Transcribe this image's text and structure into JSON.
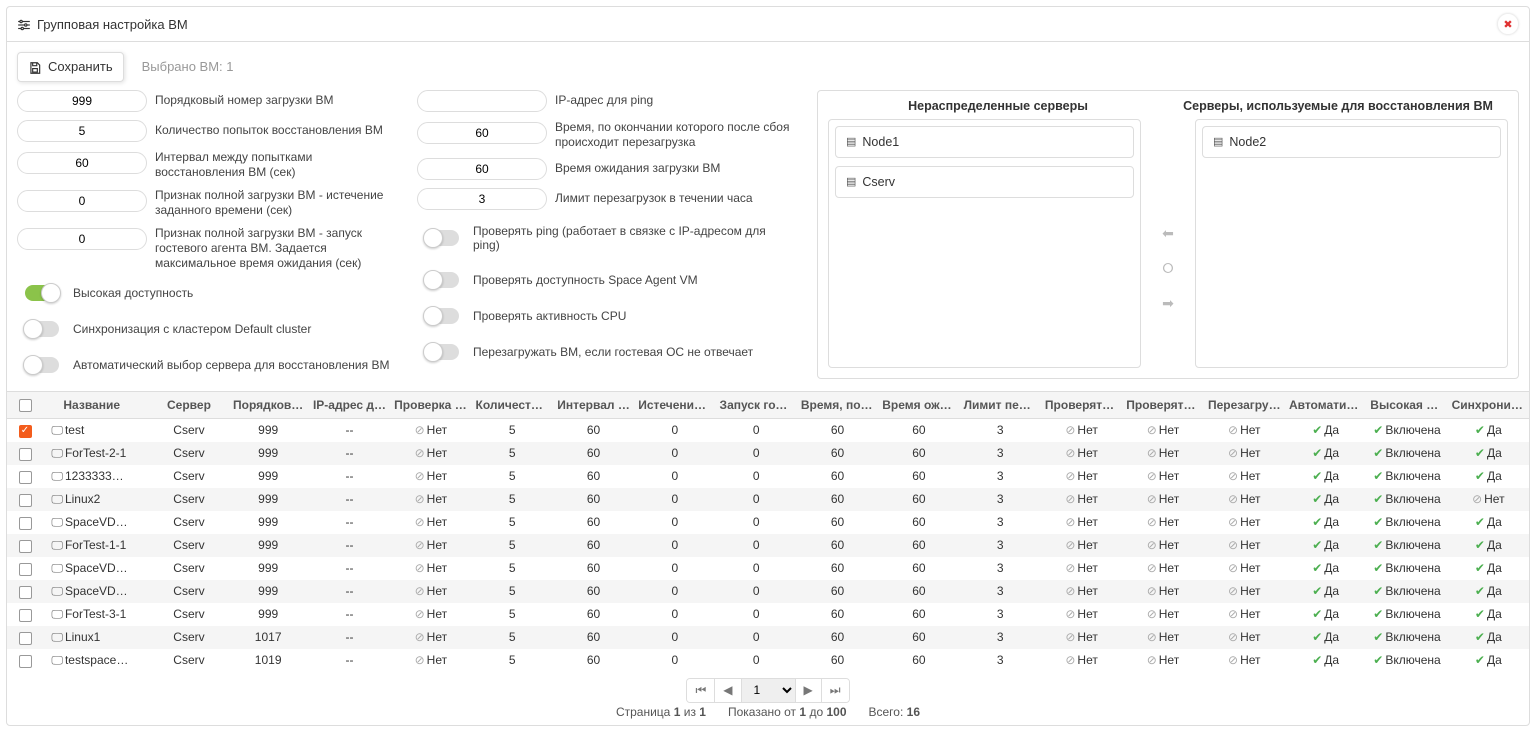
{
  "header": {
    "title": "Групповая настройка ВМ"
  },
  "toolbar": {
    "saveLabel": "Сохранить",
    "selectedLabel": "Выбрано ВМ: 1"
  },
  "left_fields": [
    {
      "value": "999",
      "label": "Порядковый номер загрузки ВМ"
    },
    {
      "value": "5",
      "label": "Количество попыток восстановления ВМ"
    },
    {
      "value": "60",
      "label": "Интервал между попытками восстановления ВМ (сек)"
    },
    {
      "value": "0",
      "label": "Признак полной загрузки ВМ - истечение заданного времени (сек)"
    },
    {
      "value": "0",
      "label": "Признак полной загрузки ВМ - запуск гостевого агента ВМ. Задается максимальное время ожидания (сек)"
    }
  ],
  "left_toggles": [
    {
      "label": "Высокая доступность",
      "on": true
    },
    {
      "label": "Синхронизация с кластером Default cluster",
      "on": false
    },
    {
      "label": "Автоматический выбор сервера для восстановления ВМ",
      "on": false
    }
  ],
  "right_fields": [
    {
      "value": "",
      "label": "IP-адрес для ping"
    },
    {
      "value": "60",
      "label": "Время, по окончании которого после сбоя происходит перезагрузка"
    },
    {
      "value": "60",
      "label": "Время ожидания загрузки ВМ"
    },
    {
      "value": "3",
      "label": "Лимит перезагрузок в течении часа"
    }
  ],
  "right_toggles": [
    {
      "label": "Проверять ping (работает в связке с IP-адресом для ping)",
      "on": false
    },
    {
      "label": "Проверять доступность Space Agent VM",
      "on": false
    },
    {
      "label": "Проверять активность CPU",
      "on": false
    },
    {
      "label": "Перезагружать ВМ, если гостевая ОС не отвечает",
      "on": false
    }
  ],
  "servers": {
    "unassignedTitle": "Нераспределенные серверы",
    "usedTitle": "Серверы, используемые для восстановления ВМ",
    "unassigned": [
      "Node1",
      "Cserv"
    ],
    "used": [
      "Node2"
    ]
  },
  "columns": [
    "",
    "Название",
    "Сервер",
    "Порядков…",
    "IP-адрес д…",
    "Проверка p…",
    "Количеств…",
    "Интервал …",
    "Истечение …",
    "Запуск гост…",
    "Время, по …",
    "Время ожи…",
    "Лимит пер…",
    "Проверять …",
    "Проверять …",
    "Перезагру…",
    "Автоматич…",
    "Высокая д…",
    "Синхрониз…"
  ],
  "statusText": {
    "no": "Нет",
    "yes": "Да",
    "enabled": "Включена"
  },
  "rows": [
    {
      "checked": true,
      "name": "test",
      "server": "Cserv",
      "ord": "999",
      "ip": "--",
      "ping": "no",
      "cnt": "5",
      "intv": "60",
      "exp": "0",
      "guest": "0",
      "after": "60",
      "wait": "60",
      "limit": "3",
      "chk1": "no",
      "chk2": "no",
      "reboot": "no",
      "auto": "yes",
      "ha": "enabled",
      "sync": "yes"
    },
    {
      "checked": false,
      "name": "ForTest-2-1",
      "server": "Cserv",
      "ord": "999",
      "ip": "--",
      "ping": "no",
      "cnt": "5",
      "intv": "60",
      "exp": "0",
      "guest": "0",
      "after": "60",
      "wait": "60",
      "limit": "3",
      "chk1": "no",
      "chk2": "no",
      "reboot": "no",
      "auto": "yes",
      "ha": "enabled",
      "sync": "yes"
    },
    {
      "checked": false,
      "name": "1233333…",
      "server": "Cserv",
      "ord": "999",
      "ip": "--",
      "ping": "no",
      "cnt": "5",
      "intv": "60",
      "exp": "0",
      "guest": "0",
      "after": "60",
      "wait": "60",
      "limit": "3",
      "chk1": "no",
      "chk2": "no",
      "reboot": "no",
      "auto": "yes",
      "ha": "enabled",
      "sync": "yes"
    },
    {
      "checked": false,
      "name": "Linux2",
      "server": "Cserv",
      "ord": "999",
      "ip": "--",
      "ping": "no",
      "cnt": "5",
      "intv": "60",
      "exp": "0",
      "guest": "0",
      "after": "60",
      "wait": "60",
      "limit": "3",
      "chk1": "no",
      "chk2": "no",
      "reboot": "no",
      "auto": "yes",
      "ha": "enabled",
      "sync": "no"
    },
    {
      "checked": false,
      "name": "SpaceVD…",
      "server": "Cserv",
      "ord": "999",
      "ip": "--",
      "ping": "no",
      "cnt": "5",
      "intv": "60",
      "exp": "0",
      "guest": "0",
      "after": "60",
      "wait": "60",
      "limit": "3",
      "chk1": "no",
      "chk2": "no",
      "reboot": "no",
      "auto": "yes",
      "ha": "enabled",
      "sync": "yes"
    },
    {
      "checked": false,
      "name": "ForTest-1-1",
      "server": "Cserv",
      "ord": "999",
      "ip": "--",
      "ping": "no",
      "cnt": "5",
      "intv": "60",
      "exp": "0",
      "guest": "0",
      "after": "60",
      "wait": "60",
      "limit": "3",
      "chk1": "no",
      "chk2": "no",
      "reboot": "no",
      "auto": "yes",
      "ha": "enabled",
      "sync": "yes"
    },
    {
      "checked": false,
      "name": "SpaceVD…",
      "server": "Cserv",
      "ord": "999",
      "ip": "--",
      "ping": "no",
      "cnt": "5",
      "intv": "60",
      "exp": "0",
      "guest": "0",
      "after": "60",
      "wait": "60",
      "limit": "3",
      "chk1": "no",
      "chk2": "no",
      "reboot": "no",
      "auto": "yes",
      "ha": "enabled",
      "sync": "yes"
    },
    {
      "checked": false,
      "name": "SpaceVD…",
      "server": "Cserv",
      "ord": "999",
      "ip": "--",
      "ping": "no",
      "cnt": "5",
      "intv": "60",
      "exp": "0",
      "guest": "0",
      "after": "60",
      "wait": "60",
      "limit": "3",
      "chk1": "no",
      "chk2": "no",
      "reboot": "no",
      "auto": "yes",
      "ha": "enabled",
      "sync": "yes"
    },
    {
      "checked": false,
      "name": "ForTest-3-1",
      "server": "Cserv",
      "ord": "999",
      "ip": "--",
      "ping": "no",
      "cnt": "5",
      "intv": "60",
      "exp": "0",
      "guest": "0",
      "after": "60",
      "wait": "60",
      "limit": "3",
      "chk1": "no",
      "chk2": "no",
      "reboot": "no",
      "auto": "yes",
      "ha": "enabled",
      "sync": "yes"
    },
    {
      "checked": false,
      "name": "Linux1",
      "server": "Cserv",
      "ord": "1017",
      "ip": "--",
      "ping": "no",
      "cnt": "5",
      "intv": "60",
      "exp": "0",
      "guest": "0",
      "after": "60",
      "wait": "60",
      "limit": "3",
      "chk1": "no",
      "chk2": "no",
      "reboot": "no",
      "auto": "yes",
      "ha": "enabled",
      "sync": "yes"
    },
    {
      "checked": false,
      "name": "testspace…",
      "server": "Cserv",
      "ord": "1019",
      "ip": "--",
      "ping": "no",
      "cnt": "5",
      "intv": "60",
      "exp": "0",
      "guest": "0",
      "after": "60",
      "wait": "60",
      "limit": "3",
      "chk1": "no",
      "chk2": "no",
      "reboot": "no",
      "auto": "yes",
      "ha": "enabled",
      "sync": "yes"
    }
  ],
  "pager": {
    "page": "1",
    "pageWord": "Страница",
    "ofWord": "из",
    "totalPages": "1",
    "shownPrefix": "Показано от",
    "shownFrom": "1",
    "toWord": "до",
    "shownTo": "100",
    "totalWord": "Всего:",
    "totalCount": "16"
  }
}
